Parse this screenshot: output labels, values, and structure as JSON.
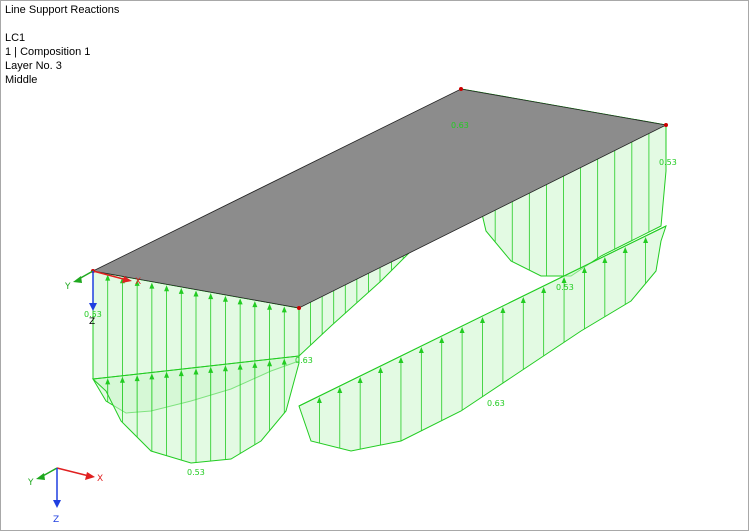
{
  "header": {
    "title": "Line Support Reactions",
    "load_case": "LC1",
    "composition": "1 | Composition 1",
    "layer": "Layer No. 3",
    "position": "Middle"
  },
  "labels": {
    "peak_top": "0.63",
    "right_end": "0.53",
    "left_end": "0.53",
    "front_peak": "0.63",
    "right_mid": "0.53",
    "front_long_mid": "0.63",
    "front_short_mid": "0.53"
  },
  "axes": {
    "x": "X",
    "y": "Y",
    "z": "Z"
  },
  "colors": {
    "diagram": "#22cc22",
    "fill": "#ccf5cc",
    "plate": "#8c8c8c",
    "x_axis": "#e02020",
    "y_axis": "#1fa81f",
    "z_axis": "#1f3fe0"
  }
}
